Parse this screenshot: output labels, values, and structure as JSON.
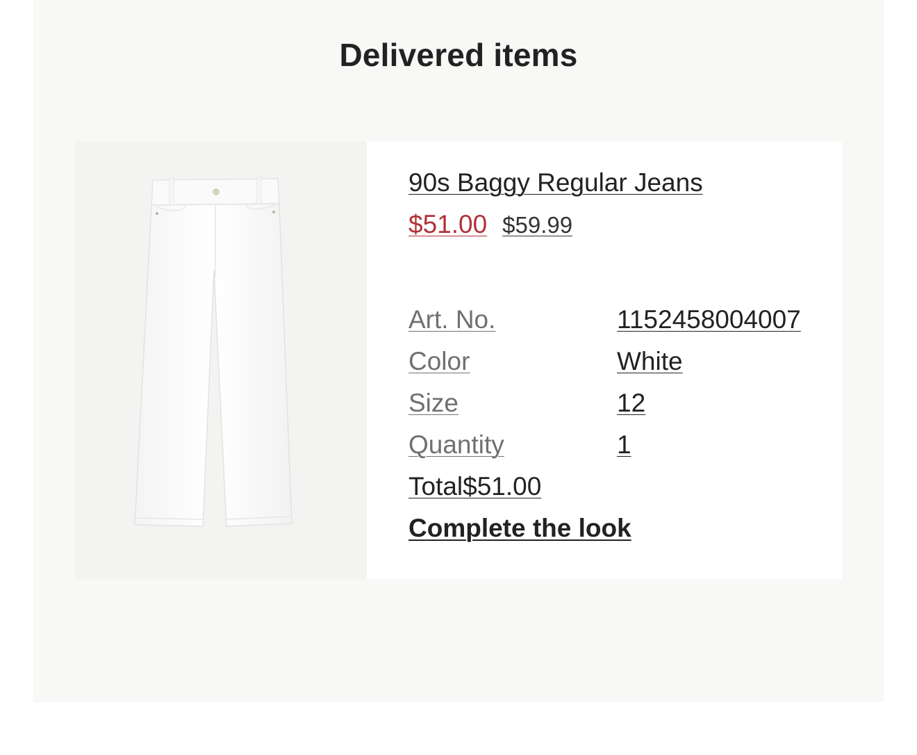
{
  "section": {
    "title": "Delivered items"
  },
  "item": {
    "name": "90s Baggy Regular Jeans",
    "sale_price": "$51.00",
    "original_price": "$59.99",
    "image_icon": "jeans-product-image",
    "attributes": [
      {
        "label": "Art. No.",
        "value": "1152458004007"
      },
      {
        "label": "Color",
        "value": "White"
      },
      {
        "label": "Size",
        "value": "12"
      },
      {
        "label": "Quantity",
        "value": "1"
      }
    ],
    "total_label": "Total",
    "total_value": "$51.00",
    "cta_label": "Complete the look"
  },
  "colors": {
    "sale": "#b1323a",
    "panel_bg": "#f8f8f6",
    "text": "#222222",
    "muted": "#707070"
  }
}
